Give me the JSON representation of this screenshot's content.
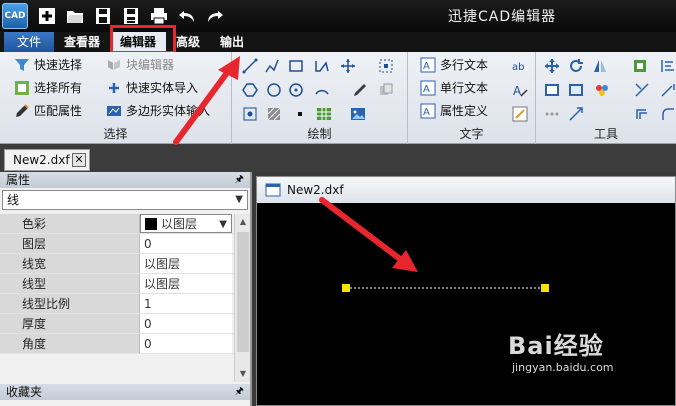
{
  "window": {
    "title": "迅捷CAD编辑器",
    "logo_text": "CAD"
  },
  "menu": {
    "file": "文件",
    "tabs": [
      "查看器",
      "编辑器",
      "高级",
      "输出"
    ],
    "active": "编辑器"
  },
  "ribbon": {
    "select": {
      "label": "选择",
      "buttons": [
        "快速选择",
        "选择所有",
        "匹配属性",
        "块编辑器",
        "快速实体导入",
        "多边形实体输入"
      ]
    },
    "draw": {
      "label": "绘制"
    },
    "text": {
      "label": "文字",
      "buttons": [
        "多行文本",
        "单行文本",
        "属性定义"
      ]
    },
    "tools": {
      "label": "工具"
    }
  },
  "document_tab": {
    "name": "New2.dxf",
    "close": "✕"
  },
  "properties": {
    "title": "属性",
    "pin": "🖈",
    "selected_type": "线",
    "rows": [
      {
        "name": "色彩",
        "value": "以图层"
      },
      {
        "name": "图层",
        "value": "0"
      },
      {
        "name": "线宽",
        "value": "以图层"
      },
      {
        "name": "线型",
        "value": "以图层"
      },
      {
        "name": "线型比例",
        "value": "1"
      },
      {
        "name": "厚度",
        "value": "0"
      },
      {
        "name": "角度",
        "value": "0"
      }
    ]
  },
  "favorites": {
    "title": "收藏夹"
  },
  "drawing": {
    "title": "New2.dxf"
  },
  "watermark": {
    "main": "Bai经验",
    "sub": "jingyan.baidu.com"
  },
  "colors": {
    "annotation_red": "#e8262d",
    "grip_yellow": "#f5e400",
    "ribbon_blue": "#2a62b0"
  }
}
